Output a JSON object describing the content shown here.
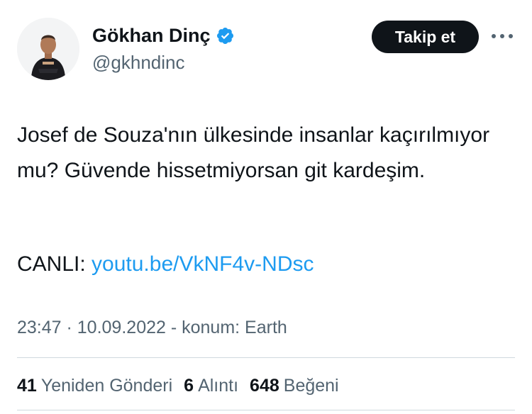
{
  "author": {
    "display_name": "Gökhan Dinç",
    "handle": "@gkhndinc",
    "verified_icon": "verified-badge-icon"
  },
  "actions": {
    "follow_label": "Takip et",
    "more_icon": "more-horizontal-icon"
  },
  "tweet": {
    "text": "Josef de Souza'nın ülkesinde insanlar kaçırılmıyor mu? Güvende hissetmiyorsan git kardeşim.",
    "live_prefix": "CANLI:",
    "link_text": "youtu.be/VkNF4v-NDsc",
    "meta": "23:47 · 10.09.2022 - konum: Earth"
  },
  "stats": {
    "retweets_count": "41",
    "retweets_label": "Yeniden Gönderi",
    "quotes_count": "6",
    "quotes_label": "Alıntı",
    "likes_count": "648",
    "likes_label": "Beğeni"
  },
  "colors": {
    "text_primary": "#0f1419",
    "text_secondary": "#536471",
    "link": "#1d9bf0",
    "follow_button_bg": "#0f1419",
    "divider": "#cfd9de"
  }
}
